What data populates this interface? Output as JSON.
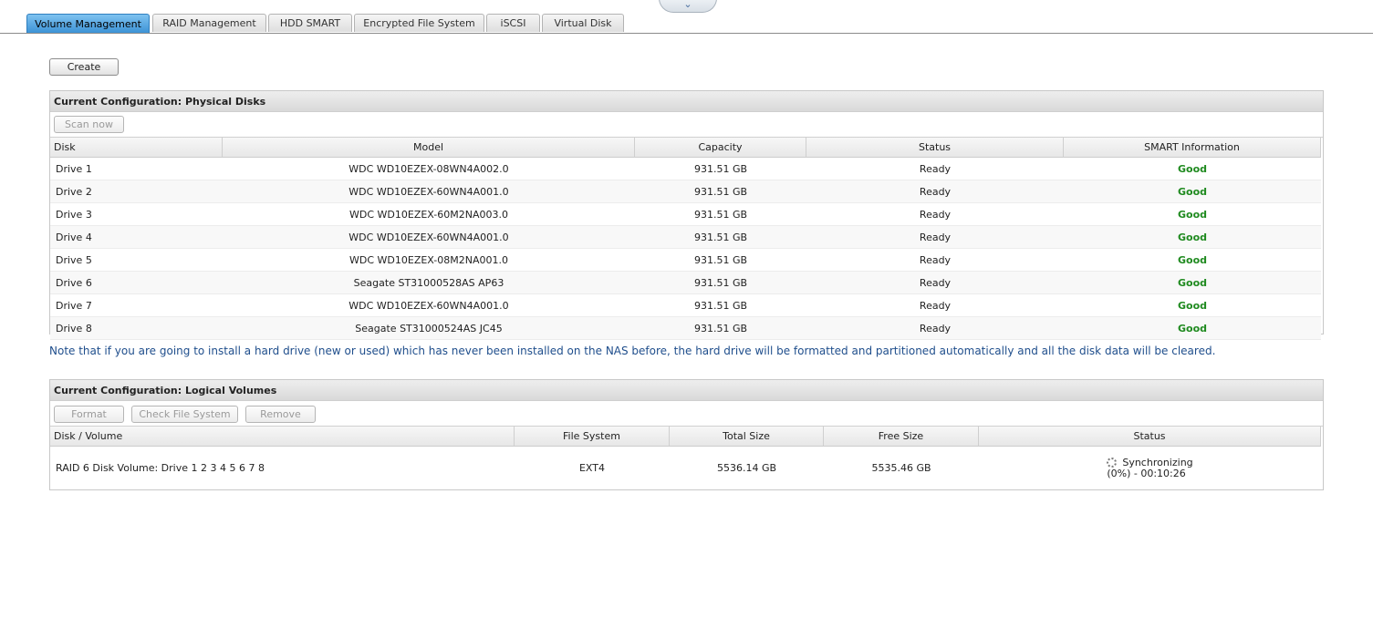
{
  "tabs": [
    {
      "label": "Volume Management",
      "active": true
    },
    {
      "label": "RAID Management",
      "active": false
    },
    {
      "label": "HDD SMART",
      "active": false
    },
    {
      "label": "Encrypted File System",
      "active": false
    },
    {
      "label": "iSCSI",
      "active": false
    },
    {
      "label": "Virtual Disk",
      "active": false
    }
  ],
  "top_handle_icon": "chevron-down-icon",
  "create_button": "Create",
  "physical_disks": {
    "title": "Current Configuration: Physical Disks",
    "scan_button": "Scan now",
    "columns": [
      "Disk",
      "Model",
      "Capacity",
      "Status",
      "SMART Information"
    ],
    "rows": [
      {
        "disk": "Drive 1",
        "model": "WDC WD10EZEX-08WN4A002.0",
        "capacity": "931.51 GB",
        "status": "Ready",
        "smart": "Good"
      },
      {
        "disk": "Drive 2",
        "model": "WDC WD10EZEX-60WN4A001.0",
        "capacity": "931.51 GB",
        "status": "Ready",
        "smart": "Good"
      },
      {
        "disk": "Drive 3",
        "model": "WDC WD10EZEX-60M2NA003.0",
        "capacity": "931.51 GB",
        "status": "Ready",
        "smart": "Good"
      },
      {
        "disk": "Drive 4",
        "model": "WDC WD10EZEX-60WN4A001.0",
        "capacity": "931.51 GB",
        "status": "Ready",
        "smart": "Good"
      },
      {
        "disk": "Drive 5",
        "model": "WDC WD10EZEX-08M2NA001.0",
        "capacity": "931.51 GB",
        "status": "Ready",
        "smart": "Good"
      },
      {
        "disk": "Drive 6",
        "model": "Seagate ST31000528AS AP63",
        "capacity": "931.51 GB",
        "status": "Ready",
        "smart": "Good"
      },
      {
        "disk": "Drive 7",
        "model": "WDC WD10EZEX-60WN4A001.0",
        "capacity": "931.51 GB",
        "status": "Ready",
        "smart": "Good"
      },
      {
        "disk": "Drive 8",
        "model": "Seagate ST31000524AS JC45",
        "capacity": "931.51 GB",
        "status": "Ready",
        "smart": "Good"
      }
    ]
  },
  "note": "Note that if you are going to install a hard drive (new or used) which has never been installed on the NAS before, the hard drive will be formatted and partitioned automatically and all the disk data will be cleared.",
  "logical_volumes": {
    "title": "Current Configuration: Logical Volumes",
    "buttons": {
      "format": "Format",
      "check": "Check File System",
      "remove": "Remove"
    },
    "columns": [
      "Disk / Volume",
      "File System",
      "Total Size",
      "Free Size",
      "Status"
    ],
    "rows": [
      {
        "volume": "RAID 6 Disk Volume: Drive 1 2 3 4 5 6 7 8",
        "fs": "EXT4",
        "total": "5536.14 GB",
        "free": "5535.46 GB",
        "status_line1": "Synchronizing",
        "status_line2": "(0%) - 00:10:26",
        "status_icon": "spinner-icon"
      }
    ]
  },
  "colors": {
    "accent_tab": "#3d93d6",
    "good": "#1f8a1f",
    "note": "#1f4e8c"
  }
}
